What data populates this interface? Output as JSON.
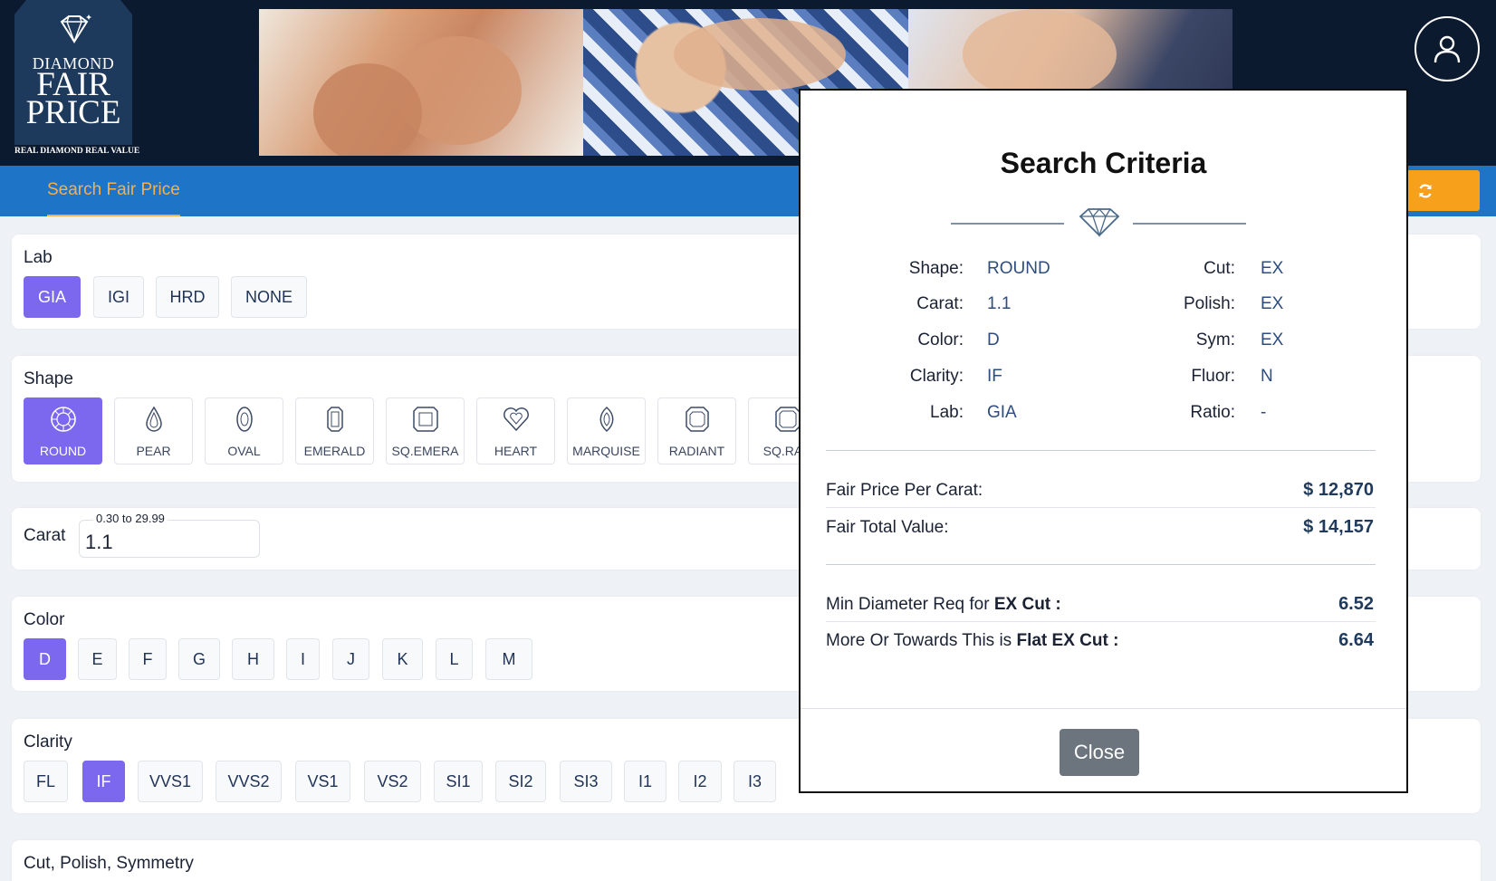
{
  "logo": {
    "line1": "DIAMOND",
    "line2": "FAIR",
    "line3": "PRICE",
    "tagline": "REAL DIAMOND REAL VALUE"
  },
  "nav": {
    "tab_label": "Search Fair Price",
    "refresh_icon": "refresh-icon",
    "accent": "#f6b04b",
    "bar_color": "#1e74c7"
  },
  "lab": {
    "title": "Lab",
    "options": [
      "GIA",
      "IGI",
      "HRD",
      "NONE"
    ],
    "selected": "GIA"
  },
  "shape": {
    "title": "Shape",
    "options": [
      "ROUND",
      "PEAR",
      "OVAL",
      "EMERALD",
      "SQ.EMERA",
      "HEART",
      "MARQUISE",
      "RADIANT",
      "SQ.RAD"
    ],
    "selected": "ROUND"
  },
  "carat": {
    "title": "Carat",
    "hint": "0.30 to 29.99",
    "value": "1.1"
  },
  "color": {
    "title": "Color",
    "options": [
      "D",
      "E",
      "F",
      "G",
      "H",
      "I",
      "J",
      "K",
      "L",
      "M"
    ],
    "selected": "D"
  },
  "clarity": {
    "title": "Clarity",
    "options": [
      "FL",
      "IF",
      "VVS1",
      "VVS2",
      "VS1",
      "VS2",
      "SI1",
      "SI2",
      "SI3",
      "I1",
      "I2",
      "I3"
    ],
    "selected": "IF"
  },
  "cps": {
    "title": "Cut, Polish, Symmetry"
  },
  "modal": {
    "title": "Search Criteria",
    "criteria_left": [
      {
        "label": "Shape:",
        "value": "ROUND"
      },
      {
        "label": "Carat:",
        "value": "1.1"
      },
      {
        "label": "Color:",
        "value": "D"
      },
      {
        "label": "Clarity:",
        "value": "IF"
      },
      {
        "label": "Lab:",
        "value": "GIA"
      }
    ],
    "criteria_right": [
      {
        "label": "Cut:",
        "value": "EX"
      },
      {
        "label": "Polish:",
        "value": "EX"
      },
      {
        "label": "Sym:",
        "value": "EX"
      },
      {
        "label": "Fluor:",
        "value": "N"
      },
      {
        "label": "Ratio:",
        "value": "-"
      }
    ],
    "fair_price_per_carat_label": "Fair Price Per Carat:",
    "fair_price_per_carat_value": "$ 12,870",
    "fair_total_value_label": "Fair Total Value:",
    "fair_total_value_value": "$ 14,157",
    "min_diameter_label_prefix": "Min Diameter Req for ",
    "min_diameter_label_bold": "EX Cut :",
    "min_diameter_value": "6.52",
    "flat_ex_label_prefix": "More Or Towards This is ",
    "flat_ex_label_bold": "Flat EX Cut :",
    "flat_ex_value": "6.64",
    "close_label": "Close"
  },
  "colors": {
    "selected": "#7b68ee",
    "header_bg": "#0c1a30",
    "refresh_btn": "#f7a01b"
  }
}
